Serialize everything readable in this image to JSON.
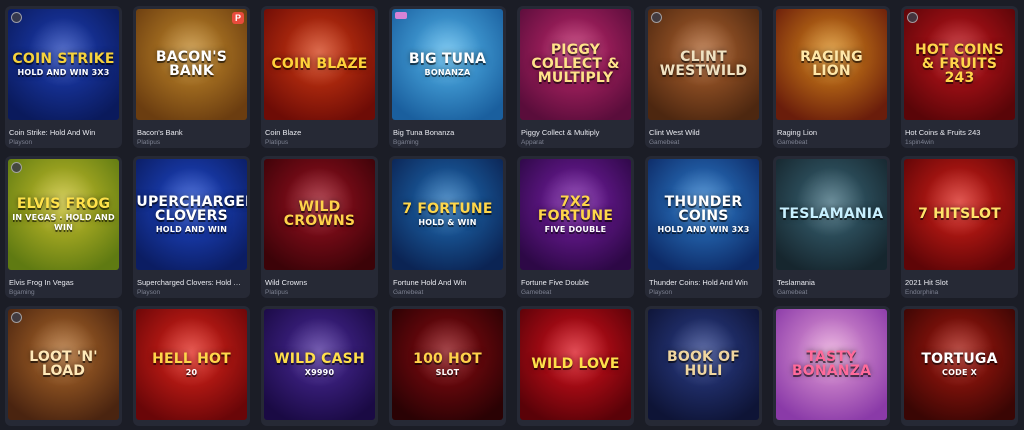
{
  "games": [
    {
      "name": "Coin Strike: Hold And Win",
      "provider": "Playson",
      "art": "COIN STRIKE",
      "sub": "HOLD AND WIN 3x3",
      "bg": "#1d3fb8",
      "bg2": "#0a1a5c",
      "fg": "#f6d23c",
      "badge": "dot"
    },
    {
      "name": "Bacon's Bank",
      "provider": "Platipus",
      "art": "BACON'S BANK",
      "sub": "",
      "bg": "#c48a2a",
      "bg2": "#6b3d10",
      "fg": "#ffffff",
      "badge": "p"
    },
    {
      "name": "Coin Blaze",
      "provider": "Platipus",
      "art": "COIN BLAZE",
      "sub": "",
      "bg": "#d23a12",
      "bg2": "#6e0c06",
      "fg": "#ffd23a",
      "badge": "none"
    },
    {
      "name": "Big Tuna Bonanza",
      "provider": "Bgaming",
      "art": "BIG TUNA",
      "sub": "BONANZA",
      "bg": "#53b6ec",
      "bg2": "#1a5f9e",
      "fg": "#ffffff",
      "badge": "pink"
    },
    {
      "name": "Piggy Collect & Multiply",
      "provider": "Apparat",
      "art": "PIGGY COLLECT & MULTIPLY",
      "sub": "",
      "bg": "#c2286c",
      "bg2": "#5a0d3b",
      "fg": "#ffe38a",
      "badge": "none"
    },
    {
      "name": "Clint West Wild",
      "provider": "Gamebeat",
      "art": "CLINT WESTWILD",
      "sub": "",
      "bg": "#b0632e",
      "bg2": "#4d2710",
      "fg": "#f0e2c2",
      "badge": "dot"
    },
    {
      "name": "Raging Lion",
      "provider": "Gamebeat",
      "art": "RAGING LION",
      "sub": "",
      "bg": "#d98a1a",
      "bg2": "#6a1d0b",
      "fg": "#ffe7a8",
      "badge": "none"
    },
    {
      "name": "Hot Coins & Fruits 243",
      "provider": "1spin4win",
      "art": "HOT COINS & FRUITS 243",
      "sub": "",
      "bg": "#c4151c",
      "bg2": "#5a0508",
      "fg": "#ffd64a",
      "badge": "dot"
    },
    {
      "name": "Elvis Frog In Vegas",
      "provider": "Bgaming",
      "art": "ELVIS FROG",
      "sub": "IN VEGAS · HOLD AND WIN",
      "bg": "#c9c02b",
      "bg2": "#5f7a12",
      "fg": "#ffe24a",
      "badge": "dot"
    },
    {
      "name": "Supercharged Clovers: Hold …",
      "provider": "Playson",
      "art": "SUPERCHARGED CLOVERS",
      "sub": "HOLD AND WIN",
      "bg": "#1f4ad0",
      "bg2": "#0b1d63",
      "fg": "#ffffff",
      "badge": "none"
    },
    {
      "name": "Wild Crowns",
      "provider": "Platipus",
      "art": "WILD CROWNS",
      "sub": "",
      "bg": "#9b1020",
      "bg2": "#3c0308",
      "fg": "#ffd24a",
      "badge": "none"
    },
    {
      "name": "Fortune Hold And Win",
      "provider": "Gamebeat",
      "art": "7 FORTUNE",
      "sub": "HOLD & WIN",
      "bg": "#1f6fb8",
      "bg2": "#0b2454",
      "fg": "#ffd64a",
      "badge": "none"
    },
    {
      "name": "Fortune Five Double",
      "provider": "Gamebeat",
      "art": "7x2 FORTUNE",
      "sub": "FIVE Double",
      "bg": "#7a1fa8",
      "bg2": "#2d0846",
      "fg": "#ffd64a",
      "badge": "none"
    },
    {
      "name": "Thunder Coins: Hold And Win",
      "provider": "Playson",
      "art": "THUNDER COINS",
      "sub": "HOLD AND WIN 3x3",
      "bg": "#2e7fcf",
      "bg2": "#0d2a66",
      "fg": "#ffffff",
      "badge": "none"
    },
    {
      "name": "Teslamania",
      "provider": "Gamebeat",
      "art": "TESLAMANIA",
      "sub": "",
      "bg": "#3a6778",
      "bg2": "#16262e",
      "fg": "#c8f0ff",
      "badge": "none"
    },
    {
      "name": "2021 Hit Slot",
      "provider": "Endorphina",
      "art": "7 HITSLOT",
      "sub": "",
      "bg": "#d82018",
      "bg2": "#5f0507",
      "fg": "#ffe36a",
      "badge": "none"
    },
    {
      "name": "",
      "provider": "",
      "art": "LOOT 'N' LOAD",
      "sub": "",
      "bg": "#b06a2a",
      "bg2": "#4a2410",
      "fg": "#ffe9b8",
      "badge": "dot"
    },
    {
      "name": "",
      "provider": "",
      "art": "HELL HOT",
      "sub": "20",
      "bg": "#e0241a",
      "bg2": "#6a0608",
      "fg": "#ffd64a",
      "badge": "none"
    },
    {
      "name": "",
      "provider": "",
      "art": "WILD CASH",
      "sub": "X9990",
      "bg": "#4a2a9a",
      "bg2": "#1a0a44",
      "fg": "#ffdf4a",
      "badge": "none"
    },
    {
      "name": "",
      "provider": "",
      "art": "100 HOT",
      "sub": "Slot",
      "bg": "#8a0a10",
      "bg2": "#2a0204",
      "fg": "#ffd14a",
      "badge": "none"
    },
    {
      "name": "",
      "provider": "",
      "art": "WILD LOVE",
      "sub": "",
      "bg": "#d8101c",
      "bg2": "#5a0208",
      "fg": "#ffe04a",
      "badge": "none"
    },
    {
      "name": "",
      "provider": "",
      "art": "BOOK OF HULI",
      "sub": "",
      "bg": "#2b3e8a",
      "bg2": "#0e1436",
      "fg": "#f0d6a0",
      "badge": "none"
    },
    {
      "name": "",
      "provider": "",
      "art": "TASTY BONANZA",
      "sub": "",
      "bg": "#e6a0d8",
      "bg2": "#8a3aa8",
      "fg": "#ff6a9a",
      "badge": "none"
    },
    {
      "name": "",
      "provider": "",
      "art": "TORTUGA",
      "sub": "CODE X",
      "bg": "#a8180e",
      "bg2": "#3a0604",
      "fg": "#ffffff",
      "badge": "none"
    }
  ]
}
